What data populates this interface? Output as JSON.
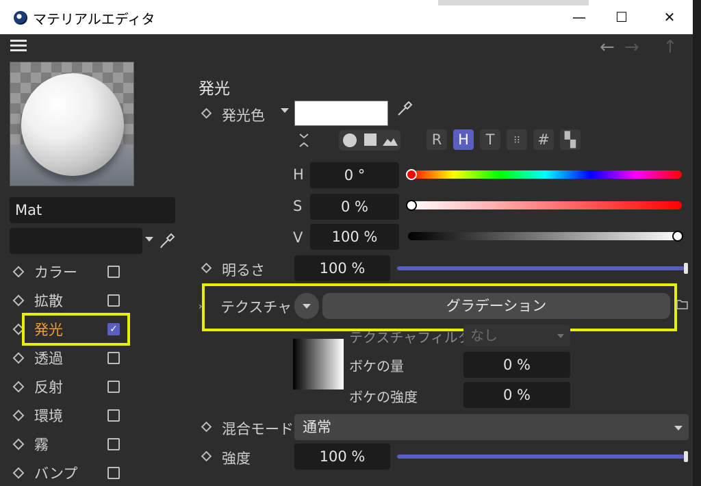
{
  "window": {
    "title": "マテリアルエディタ",
    "minimize": "—",
    "maximize": "☐",
    "close": "✕"
  },
  "toolbar": {
    "back": "←",
    "forward": "→",
    "up": "↑"
  },
  "material": {
    "name": "Mat",
    "sub_value": ""
  },
  "channels": [
    {
      "label": "カラー",
      "checked": false
    },
    {
      "label": "拡散",
      "checked": false
    },
    {
      "label": "発光",
      "checked": true
    },
    {
      "label": "透過",
      "checked": false
    },
    {
      "label": "反射",
      "checked": false
    },
    {
      "label": "環境",
      "checked": false
    },
    {
      "label": "霧",
      "checked": false
    },
    {
      "label": "バンプ",
      "checked": false
    }
  ],
  "panel": {
    "section_title": "発光",
    "color_label": "発光色",
    "swatch_color": "#ffffff",
    "color_modes": [
      "R",
      "H",
      "T",
      "⁝⁝",
      "#",
      "▚"
    ],
    "hsv": [
      {
        "label": "H",
        "value": "0 °"
      },
      {
        "label": "S",
        "value": "0 %"
      },
      {
        "label": "V",
        "value": "100 %"
      }
    ],
    "brightness": {
      "label": "明るさ",
      "value": "100 %",
      "level": 1.0
    },
    "texture": {
      "label": "テクスチャ",
      "shader": "グラデーション"
    },
    "texture_filter": {
      "label": "テクスチャフィルタ",
      "value": "なし"
    },
    "blur_offset": {
      "label": "ボケの量",
      "value": "0 %"
    },
    "blur_strength": {
      "label": "ボケの強度",
      "value": "0 %"
    },
    "mix_mode": {
      "label": "混合モード",
      "value": "通常"
    },
    "strength": {
      "label": "強度",
      "value": "100 %",
      "level": 1.0
    },
    "accent_color": "#5a5fbf",
    "highlight_color": "#e6f000"
  }
}
